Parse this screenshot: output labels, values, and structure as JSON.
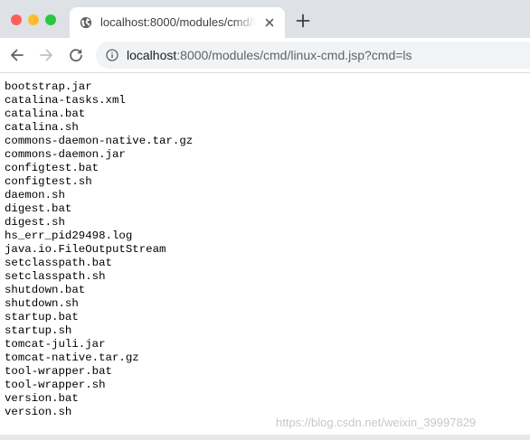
{
  "tab": {
    "title": "localhost:8000/modules/cmd/linux-cmd.jsp?cmd=ls"
  },
  "address_bar": {
    "host": "localhost",
    "rest": ":8000/modules/cmd/linux-cmd.jsp?cmd=ls"
  },
  "files": [
    "bootstrap.jar",
    "catalina-tasks.xml",
    "catalina.bat",
    "catalina.sh",
    "commons-daemon-native.tar.gz",
    "commons-daemon.jar",
    "configtest.bat",
    "configtest.sh",
    "daemon.sh",
    "digest.bat",
    "digest.sh",
    "hs_err_pid29498.log",
    "java.io.FileOutputStream",
    "setclasspath.bat",
    "setclasspath.sh",
    "shutdown.bat",
    "shutdown.sh",
    "startup.bat",
    "startup.sh",
    "tomcat-juli.jar",
    "tomcat-native.tar.gz",
    "tool-wrapper.bat",
    "tool-wrapper.sh",
    "version.bat",
    "version.sh"
  ],
  "watermark": "https://blog.csdn.net/weixin_39997829",
  "icons": {
    "favicon": "globe-icon",
    "tab_close": "close-icon",
    "new_tab": "plus-icon",
    "back": "arrow-left-icon",
    "forward": "arrow-right-icon",
    "reload": "reload-icon",
    "site_info": "info-icon"
  },
  "colors": {
    "tabstrip_bg": "#dee1e6",
    "omnibox_bg": "#f1f3f4",
    "close_dot": "#fe5f57",
    "minimize_dot": "#febc2e",
    "maximize_dot": "#28c840"
  }
}
